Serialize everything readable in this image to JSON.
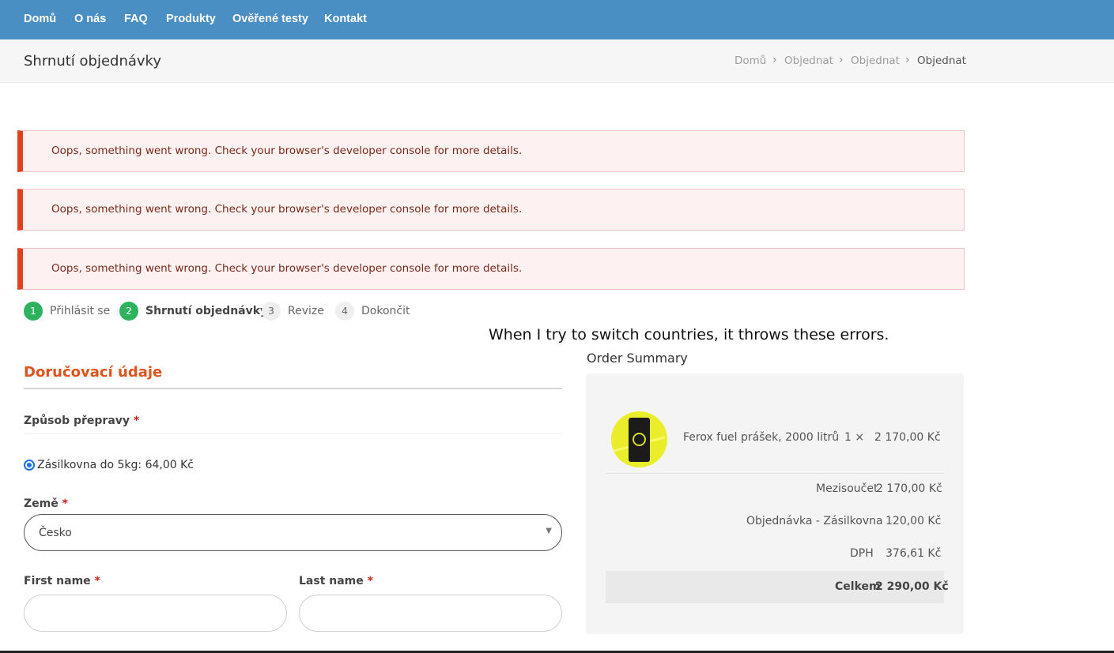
{
  "nav": {
    "items": [
      "Domů",
      "O nás",
      "FAQ",
      "Produkty",
      "Ověřené testy",
      "Kontakt"
    ]
  },
  "page": {
    "title": "Shrnutí objednávky",
    "breadcrumb": [
      "Domů",
      "Objednat",
      "Objednat",
      "Objednat"
    ]
  },
  "alerts": [
    "Oops, something went wrong. Check your browser's developer console for more details.",
    "Oops, something went wrong. Check your browser's developer console for more details.",
    "Oops, something went wrong. Check your browser's developer console for more details."
  ],
  "steps": [
    {
      "num": "1",
      "label": "Přihlásit se"
    },
    {
      "num": "2",
      "label": "Shrnutí objednávky"
    },
    {
      "num": "3",
      "label": "Revize"
    },
    {
      "num": "4",
      "label": "Dokončit"
    }
  ],
  "annotation": "When I try to switch countries, it throws these errors.",
  "form": {
    "section_title": "Doručovací údaje",
    "shipping_label": "Způsob přepravy",
    "shipping_option": "Zásilkovna do 5kg: 64,00 Kč",
    "country_label": "Země",
    "country_value": "Česko",
    "first_name_label": "First name",
    "last_name_label": "Last name",
    "required_mark": "*"
  },
  "summary": {
    "heading": "Order Summary",
    "product_name": "Ferox fuel prášek, 2000 litrů",
    "product_qty": "1 ×",
    "product_price": "2 170,00 Kč",
    "subtotal_label": "Mezisoučet",
    "subtotal_value": "2 170,00 Kč",
    "shipping_label": "Objednávka - Zásilkovna",
    "shipping_value": "120,00 Kč",
    "tax_label": "DPH",
    "tax_value": "376,61 Kč",
    "total_label": "Celkem",
    "total_value": "2 290,00 Kč"
  },
  "colors": {
    "nav_bg": "#4a8fc4",
    "accent_orange": "#e0531d",
    "step_done": "#2db35e",
    "alert_border": "#e2401c"
  }
}
